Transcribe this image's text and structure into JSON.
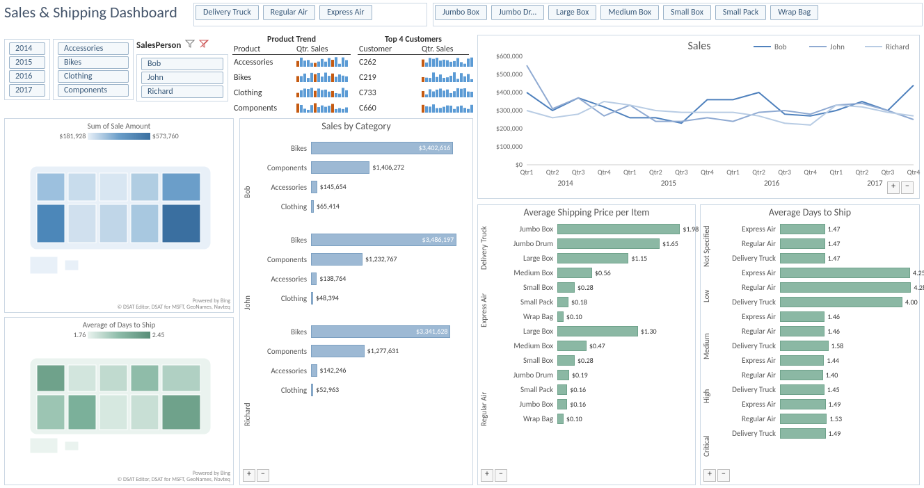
{
  "title": "Sales & Shipping Dashboard",
  "shipModes": [
    "Delivery Truck",
    "Regular Air",
    "Express Air"
  ],
  "containers": [
    "Jumbo Box",
    "Jumbo Dr...",
    "Large Box",
    "Medium Box",
    "Small Box",
    "Small Pack",
    "Wrap Bag"
  ],
  "years": [
    "2014",
    "2015",
    "2016",
    "2017"
  ],
  "categories": [
    "Accessories",
    "Bikes",
    "Clothing",
    "Components"
  ],
  "salespersonHead": "SalesPerson",
  "salespersons": [
    "Bob",
    "John",
    "Richard"
  ],
  "productTrend": {
    "title": "Product Trend",
    "head1": "Product",
    "head2": "Qtr. Sales",
    "rows": [
      "Accessories",
      "Bikes",
      "Clothing",
      "Components"
    ]
  },
  "topCustomers": {
    "title": "Top 4 Customers",
    "head1": "Customer",
    "head2": "Qtr. Sales",
    "rows": [
      "C262",
      "C219",
      "C733",
      "C660"
    ]
  },
  "map1": {
    "title": "Sum of Sale Amount",
    "min": "$181,928",
    "max": "$573,760",
    "credit1": "Powered by Bing",
    "credit2": "© DSAT Editor, DSAT for MSFT, GeoNames, Navteq"
  },
  "map2": {
    "title": "Average of Days to Ship",
    "min": "1.76",
    "max": "2.45",
    "credit1": "Powered by Bing",
    "credit2": "© DSAT Editor, DSAT for MSFT, GeoNames, Navteq"
  },
  "salesByCat": {
    "title": "Sales by Category",
    "groups": [
      {
        "name": "Bob",
        "bars": [
          {
            "c": "Bikes",
            "v": 3402616,
            "t": "$3,402,616"
          },
          {
            "c": "Components",
            "v": 1406272,
            "t": "$1,406,272"
          },
          {
            "c": "Accessories",
            "v": 145654,
            "t": "$145,654"
          },
          {
            "c": "Clothing",
            "v": 65414,
            "t": "$65,414"
          }
        ]
      },
      {
        "name": "John",
        "bars": [
          {
            "c": "Bikes",
            "v": 3486197,
            "t": "$3,486,197"
          },
          {
            "c": "Components",
            "v": 1232767,
            "t": "$1,232,767"
          },
          {
            "c": "Accessories",
            "v": 138764,
            "t": "$138,764"
          },
          {
            "c": "Clothing",
            "v": 48394,
            "t": "$48,394"
          }
        ]
      },
      {
        "name": "Richard",
        "bars": [
          {
            "c": "Bikes",
            "v": 3341628,
            "t": "$3,341,628"
          },
          {
            "c": "Components",
            "v": 1277631,
            "t": "$1,277,631"
          },
          {
            "c": "Accessories",
            "v": 142246,
            "t": "$142,246"
          },
          {
            "c": "Clothing",
            "v": 52963,
            "t": "$52,963"
          }
        ]
      }
    ],
    "max": 3800000
  },
  "chart_data": [
    {
      "type": "line",
      "title": "Sales",
      "x": [
        "Qtr1",
        "Qtr2",
        "Qtr3",
        "Qtr4",
        "Qtr1",
        "Qtr2",
        "Qtr3",
        "Qtr4",
        "Qtr1",
        "Qtr2",
        "Qtr3",
        "Qtr4",
        "Qtr1",
        "Qtr2",
        "Qtr3",
        "Qtr4"
      ],
      "year_groups": [
        "2014",
        "2015",
        "2016",
        "2017"
      ],
      "ylim": [
        0,
        600000
      ],
      "yticks": [
        "$0",
        "$100,000",
        "$200,000",
        "$300,000",
        "$400,000",
        "$500,000",
        "$600,000"
      ],
      "series": [
        {
          "name": "Bob",
          "color": "#4f81bd",
          "values": [
            400000,
            300000,
            370000,
            320000,
            260000,
            260000,
            230000,
            360000,
            360000,
            400000,
            280000,
            270000,
            300000,
            350000,
            300000,
            440000
          ]
        },
        {
          "name": "John",
          "color": "#8faad2",
          "values": [
            550000,
            310000,
            370000,
            270000,
            330000,
            240000,
            240000,
            260000,
            240000,
            290000,
            300000,
            280000,
            330000,
            340000,
            300000,
            250000
          ]
        },
        {
          "name": "Richard",
          "color": "#b8cce4",
          "values": [
            300000,
            260000,
            280000,
            350000,
            330000,
            300000,
            290000,
            290000,
            290000,
            270000,
            230000,
            220000,
            330000,
            320000,
            290000,
            270000
          ]
        }
      ]
    },
    {
      "type": "bar",
      "title": "Average Shipping Price per Item",
      "groups": [
        {
          "name": "Delivery Truck",
          "bars": [
            {
              "c": "Jumbo Box",
              "v": 1.98
            },
            {
              "c": "Jumbo Drum",
              "v": 1.65
            },
            {
              "c": "Large Box",
              "v": 1.15
            }
          ]
        },
        {
          "name": "Express Air",
          "bars": [
            {
              "c": "Medium Box",
              "v": 0.56
            },
            {
              "c": "Small Box",
              "v": 0.28
            },
            {
              "c": "Small Pack",
              "v": 0.18
            },
            {
              "c": "Wrap Bag",
              "v": 0.1
            }
          ]
        },
        {
          "name": "Regular Air",
          "bars": [
            {
              "c": "Large Box",
              "v": 1.3
            },
            {
              "c": "Medium Box",
              "v": 0.47
            },
            {
              "c": "Small Box",
              "v": 0.28
            },
            {
              "c": "Jumbo Drum",
              "v": 0.19
            },
            {
              "c": "Small Pack",
              "v": 0.16
            },
            {
              "c": "Jumbo Box",
              "v": 0.16
            },
            {
              "c": "Wrap Bag",
              "v": 0.1
            }
          ]
        }
      ],
      "max": 2.2
    },
    {
      "type": "bar",
      "title": "Average Days to Ship",
      "groups": [
        {
          "name": "Not Specified",
          "bars": [
            {
              "c": "Express Air",
              "v": 1.47
            },
            {
              "c": "Regular Air",
              "v": 1.47
            },
            {
              "c": "Delivery Truck",
              "v": 1.47
            }
          ]
        },
        {
          "name": "Low",
          "bars": [
            {
              "c": "Express Air",
              "v": 4.25
            },
            {
              "c": "Regular Air",
              "v": 4.28
            },
            {
              "c": "Delivery Truck",
              "v": 4.0
            }
          ]
        },
        {
          "name": "Medium",
          "bars": [
            {
              "c": "Express Air",
              "v": 1.46
            },
            {
              "c": "Regular Air",
              "v": 1.46
            },
            {
              "c": "Delivery Truck",
              "v": 1.58
            }
          ]
        },
        {
          "name": "High",
          "bars": [
            {
              "c": "Express Air",
              "v": 1.44
            },
            {
              "c": "Regular Air",
              "v": 1.4
            },
            {
              "c": "Delivery Truck",
              "v": 1.45
            }
          ]
        },
        {
          "name": "Critical",
          "bars": [
            {
              "c": "Express Air",
              "v": 1.49
            },
            {
              "c": "Regular Air",
              "v": 1.53
            },
            {
              "c": "Delivery Truck",
              "v": 1.49
            }
          ]
        }
      ],
      "max": 4.5
    }
  ]
}
